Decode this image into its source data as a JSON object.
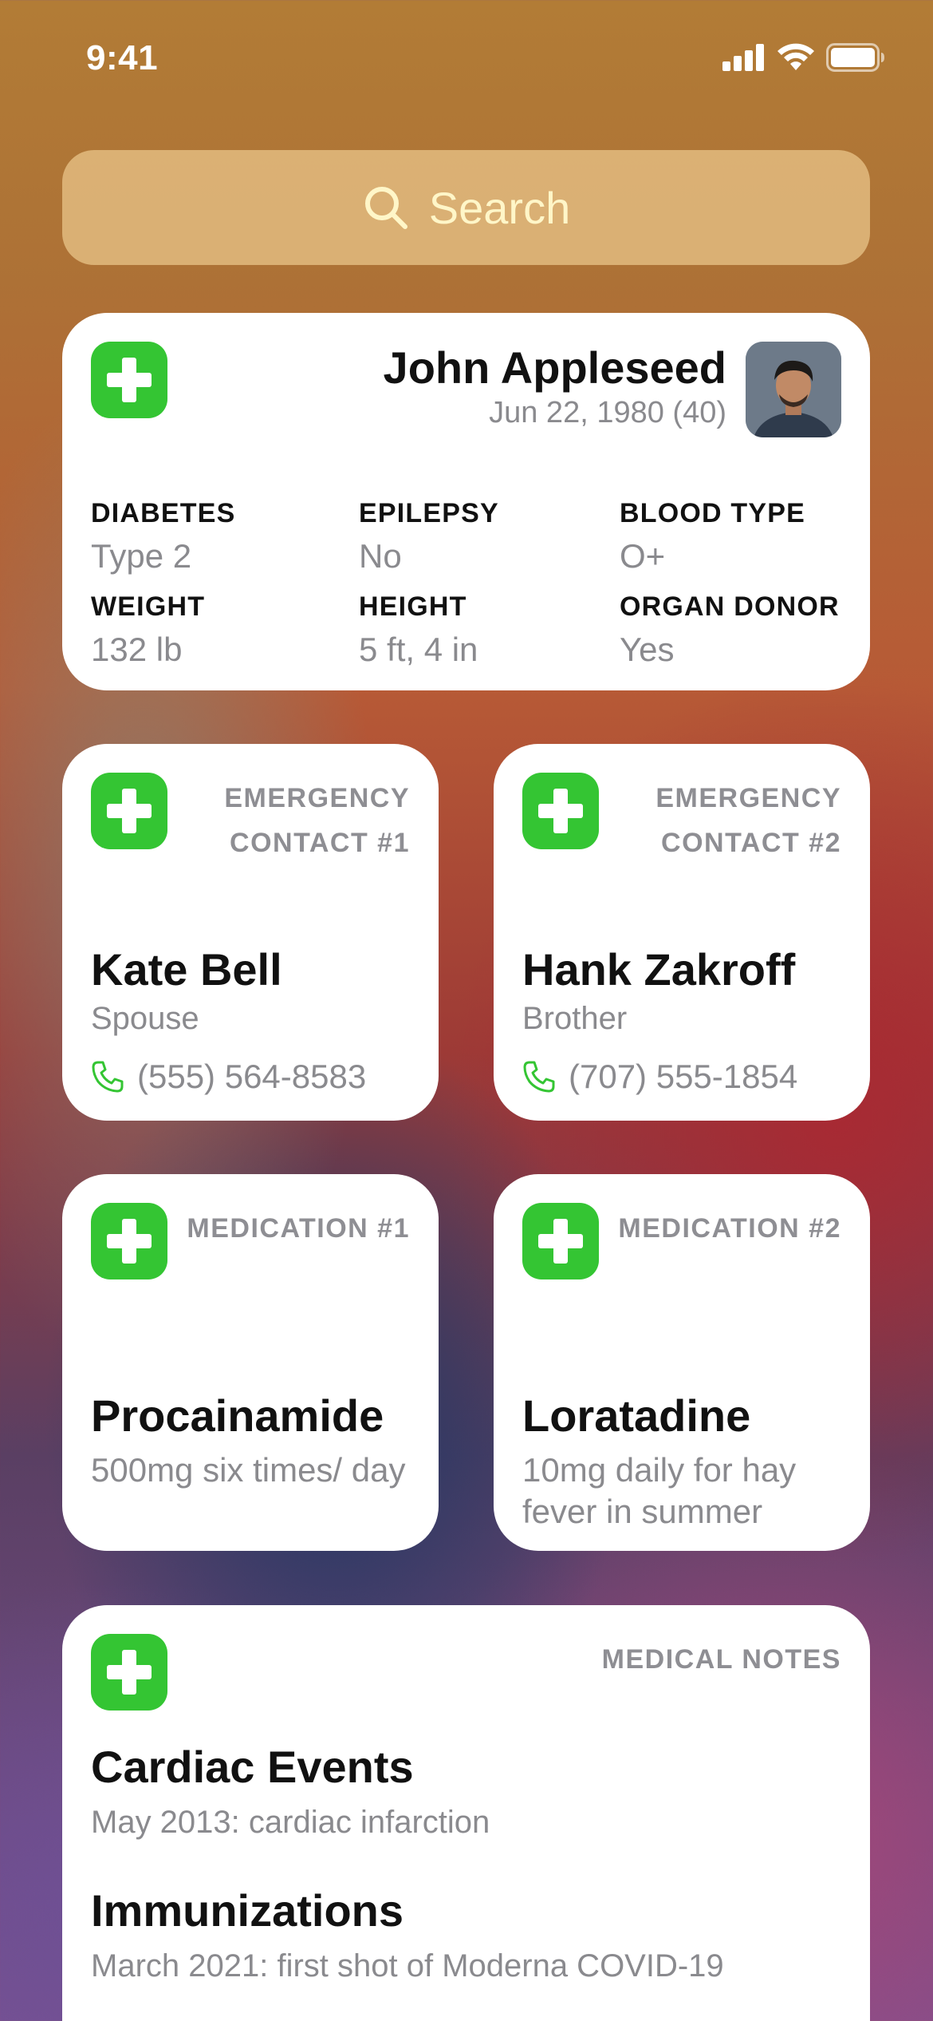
{
  "status_bar": {
    "time": "9:41"
  },
  "search": {
    "label": "Search"
  },
  "profile": {
    "name": "John Appleseed",
    "dob": "Jun 22, 1980 (40)",
    "fields": [
      {
        "label": "DIABETES",
        "value": "Type 2"
      },
      {
        "label": "EPILEPSY",
        "value": "No"
      },
      {
        "label": "BLOOD TYPE",
        "value": "O+"
      },
      {
        "label": "WEIGHT",
        "value": "132 lb"
      },
      {
        "label": "HEIGHT",
        "value": "5 ft, 4 in"
      },
      {
        "label": "ORGAN DONOR",
        "value": "Yes"
      }
    ]
  },
  "contacts": [
    {
      "header_line1": "EMERGENCY",
      "header_line2": "CONTACT #1",
      "name": "Kate Bell",
      "relation": "Spouse",
      "phone": "(555) 564-8583"
    },
    {
      "header_line1": "EMERGENCY",
      "header_line2": "CONTACT #2",
      "name": "Hank Zakroff",
      "relation": "Brother",
      "phone": "(707) 555-1854"
    }
  ],
  "medications": [
    {
      "header": "MEDICATION #1",
      "name": "Procainamide",
      "dose": "500mg six times/ day"
    },
    {
      "header": "MEDICATION #2",
      "name": "Loratadine",
      "dose": "10mg daily for hay fever in summer"
    }
  ],
  "notes": {
    "header": "MEDICAL NOTES",
    "items": [
      {
        "title": "Cardiac Events",
        "text": "May 2013: cardiac infarction"
      },
      {
        "title": "Immunizations",
        "text": "March 2021: first shot of Moderna COVID-19"
      }
    ]
  },
  "colors": {
    "accent_green": "#34c533",
    "card_bg": "#ffffff",
    "secondary_text": "#8a8a8e"
  },
  "icons": [
    "cellular-signal-icon",
    "wifi-icon",
    "battery-icon",
    "search-icon",
    "medical-id-plus-icon",
    "phone-icon"
  ]
}
